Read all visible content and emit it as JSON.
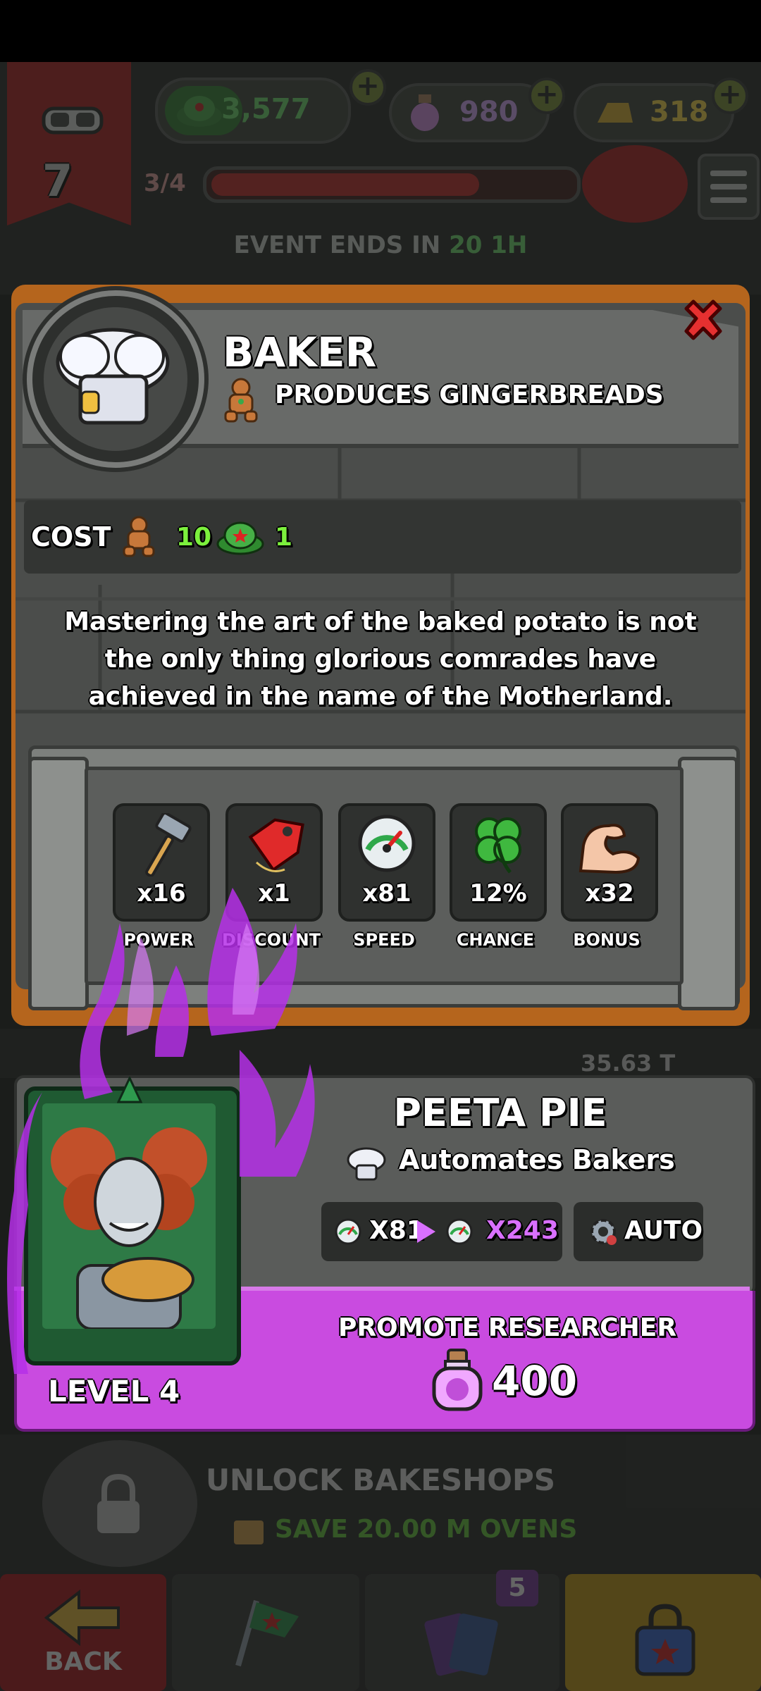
{
  "hud": {
    "rank_level": "7",
    "currency_hats": "3,577",
    "currency_potions": "980",
    "currency_gold": "318",
    "progress_text": "3/4",
    "event_prefix": "EVENT ENDS IN",
    "event_time": "20 1H"
  },
  "panel": {
    "title": "BAKER",
    "subtitle": "PRODUCES GINGERBREADS",
    "cost_label": "COST",
    "cost_gingerbread": "10",
    "cost_hat": "1",
    "description": "Mastering the art of the baked potato is not the only thing glorious comrades have achieved in the name of the Motherland.",
    "stats": [
      {
        "value": "x16",
        "label": "POWER",
        "icon": "hammer-icon"
      },
      {
        "value": "x1",
        "label": "DISCOUNT",
        "icon": "price-tag-icon"
      },
      {
        "value": "x81",
        "label": "SPEED",
        "icon": "speedometer-icon"
      },
      {
        "value": "12%",
        "label": "CHANCE",
        "icon": "clover-icon"
      },
      {
        "value": "x32",
        "label": "BONUS",
        "icon": "flexed-arm-icon"
      }
    ]
  },
  "background_value": "35.63 T",
  "researcher": {
    "name": "PEETA PIE",
    "subtitle": "Automates Bakers",
    "speed_from": "X81",
    "speed_to": "X243",
    "auto_label": "AUTO",
    "promote_label": "PROMOTE RESEARCHER",
    "level_label": "LEVEL 4",
    "promote_cost": "400"
  },
  "bottom": {
    "unlock_title": "UNLOCK BAKESHOPS",
    "unlock_sub": "SAVE 20.00 M OVENS",
    "back_label": "BACK",
    "cards_badge": "5"
  },
  "colors": {
    "accent_purple": "#c94be0",
    "panel_wood": "#b5651d",
    "cost_green": "#7cf03d",
    "speed_purple": "#d970ff"
  }
}
